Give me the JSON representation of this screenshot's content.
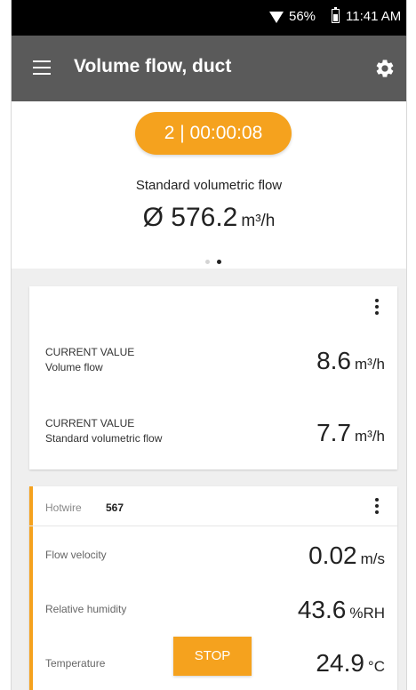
{
  "status_bar": {
    "battery": "56%",
    "time": "11:41 AM"
  },
  "header": {
    "title": "Volume flow, duct"
  },
  "summary": {
    "timer": "2 | 00:00:08",
    "label": "Standard volumetric flow",
    "average_value": "Ø 576.2",
    "average_unit": "m³/h",
    "page_indicator": {
      "pages": 2,
      "active": 2
    }
  },
  "current_card": {
    "rows": [
      {
        "label_line1": "CURRENT VALUE",
        "label_line2": "Volume flow",
        "value": "8.6",
        "unit": "m³/h"
      },
      {
        "label_line1": "CURRENT VALUE",
        "label_line2": "Standard volumetric flow",
        "value": "7.7",
        "unit": "m³/h"
      }
    ]
  },
  "probe_card": {
    "probe_type": "Hotwire",
    "probe_id": "567",
    "rows": [
      {
        "label": "Flow velocity",
        "value": "0.02",
        "unit": "m/s"
      },
      {
        "label": "Relative humidity",
        "value": "43.6",
        "unit": "%RH"
      },
      {
        "label": "Temperature",
        "value": "24.9",
        "unit": "°C"
      }
    ],
    "stop_label": "STOP"
  },
  "colors": {
    "accent": "#f5a21e",
    "header": "#5a5a5a",
    "status_bar": "#000000"
  }
}
